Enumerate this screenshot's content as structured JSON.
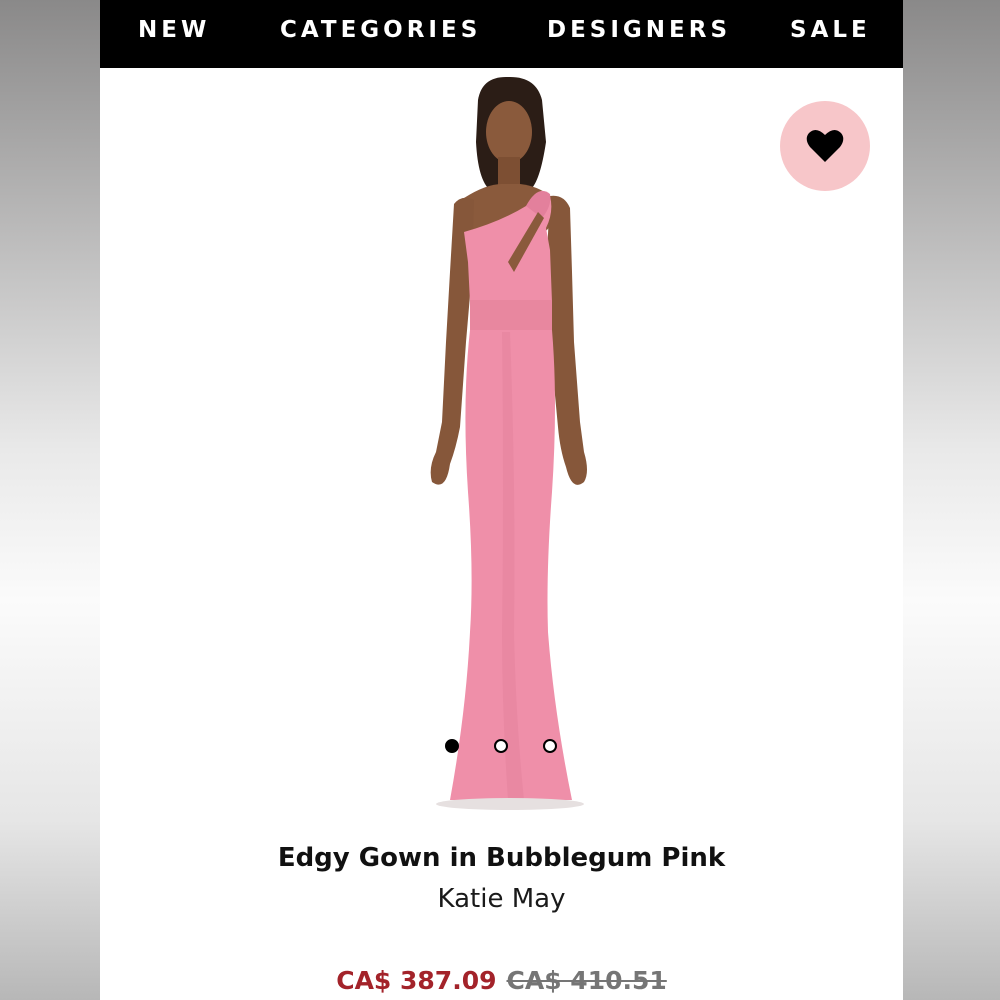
{
  "nav": {
    "items": [
      {
        "label": "NEW"
      },
      {
        "label": "CATEGORIES"
      },
      {
        "label": "DESIGNERS"
      },
      {
        "label": "SALE"
      }
    ],
    "background": "#000000",
    "text_color": "#ffffff"
  },
  "product": {
    "title": "Edgy Gown in Bubblegum Pink",
    "brand": "Katie May",
    "sale_price": "CA$ 387.09",
    "original_price": "CA$ 410.51",
    "dress_color": "#ef8fa9",
    "sale_price_color": "#a3232a"
  },
  "favorite": {
    "icon": "heart-icon",
    "background": "#f7c6c9"
  },
  "carousel": {
    "total": 3,
    "active_index": 0
  }
}
